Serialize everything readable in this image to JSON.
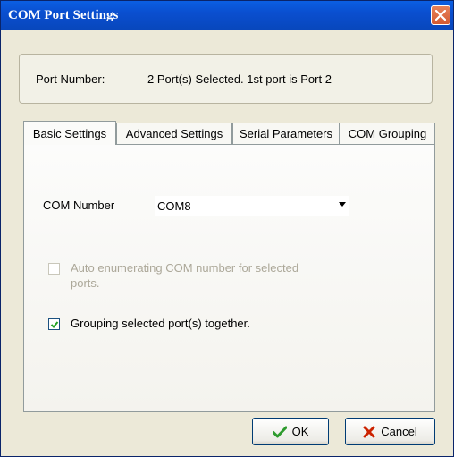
{
  "window": {
    "title": "COM Port Settings"
  },
  "port": {
    "label": "Port Number:",
    "value": "2 Port(s) Selected. 1st port is Port 2"
  },
  "tabs": [
    {
      "label": "Basic Settings",
      "active": true
    },
    {
      "label": "Advanced Settings",
      "active": false
    },
    {
      "label": "Serial Parameters",
      "active": false
    },
    {
      "label": "COM Grouping",
      "active": false
    }
  ],
  "basic": {
    "com_label": "COM Number",
    "com_value": "COM8",
    "auto_enum_label": "Auto enumerating COM number for selected ports.",
    "auto_enum_checked": false,
    "auto_enum_enabled": false,
    "grouping_label": "Grouping selected port(s) together.",
    "grouping_checked": true
  },
  "buttons": {
    "ok": "OK",
    "cancel": "Cancel"
  },
  "colors": {
    "titlebar": "#0a4fd0",
    "face": "#ece9d8",
    "ok_check": "#2e9b2e",
    "cancel_x": "#cc2200"
  }
}
